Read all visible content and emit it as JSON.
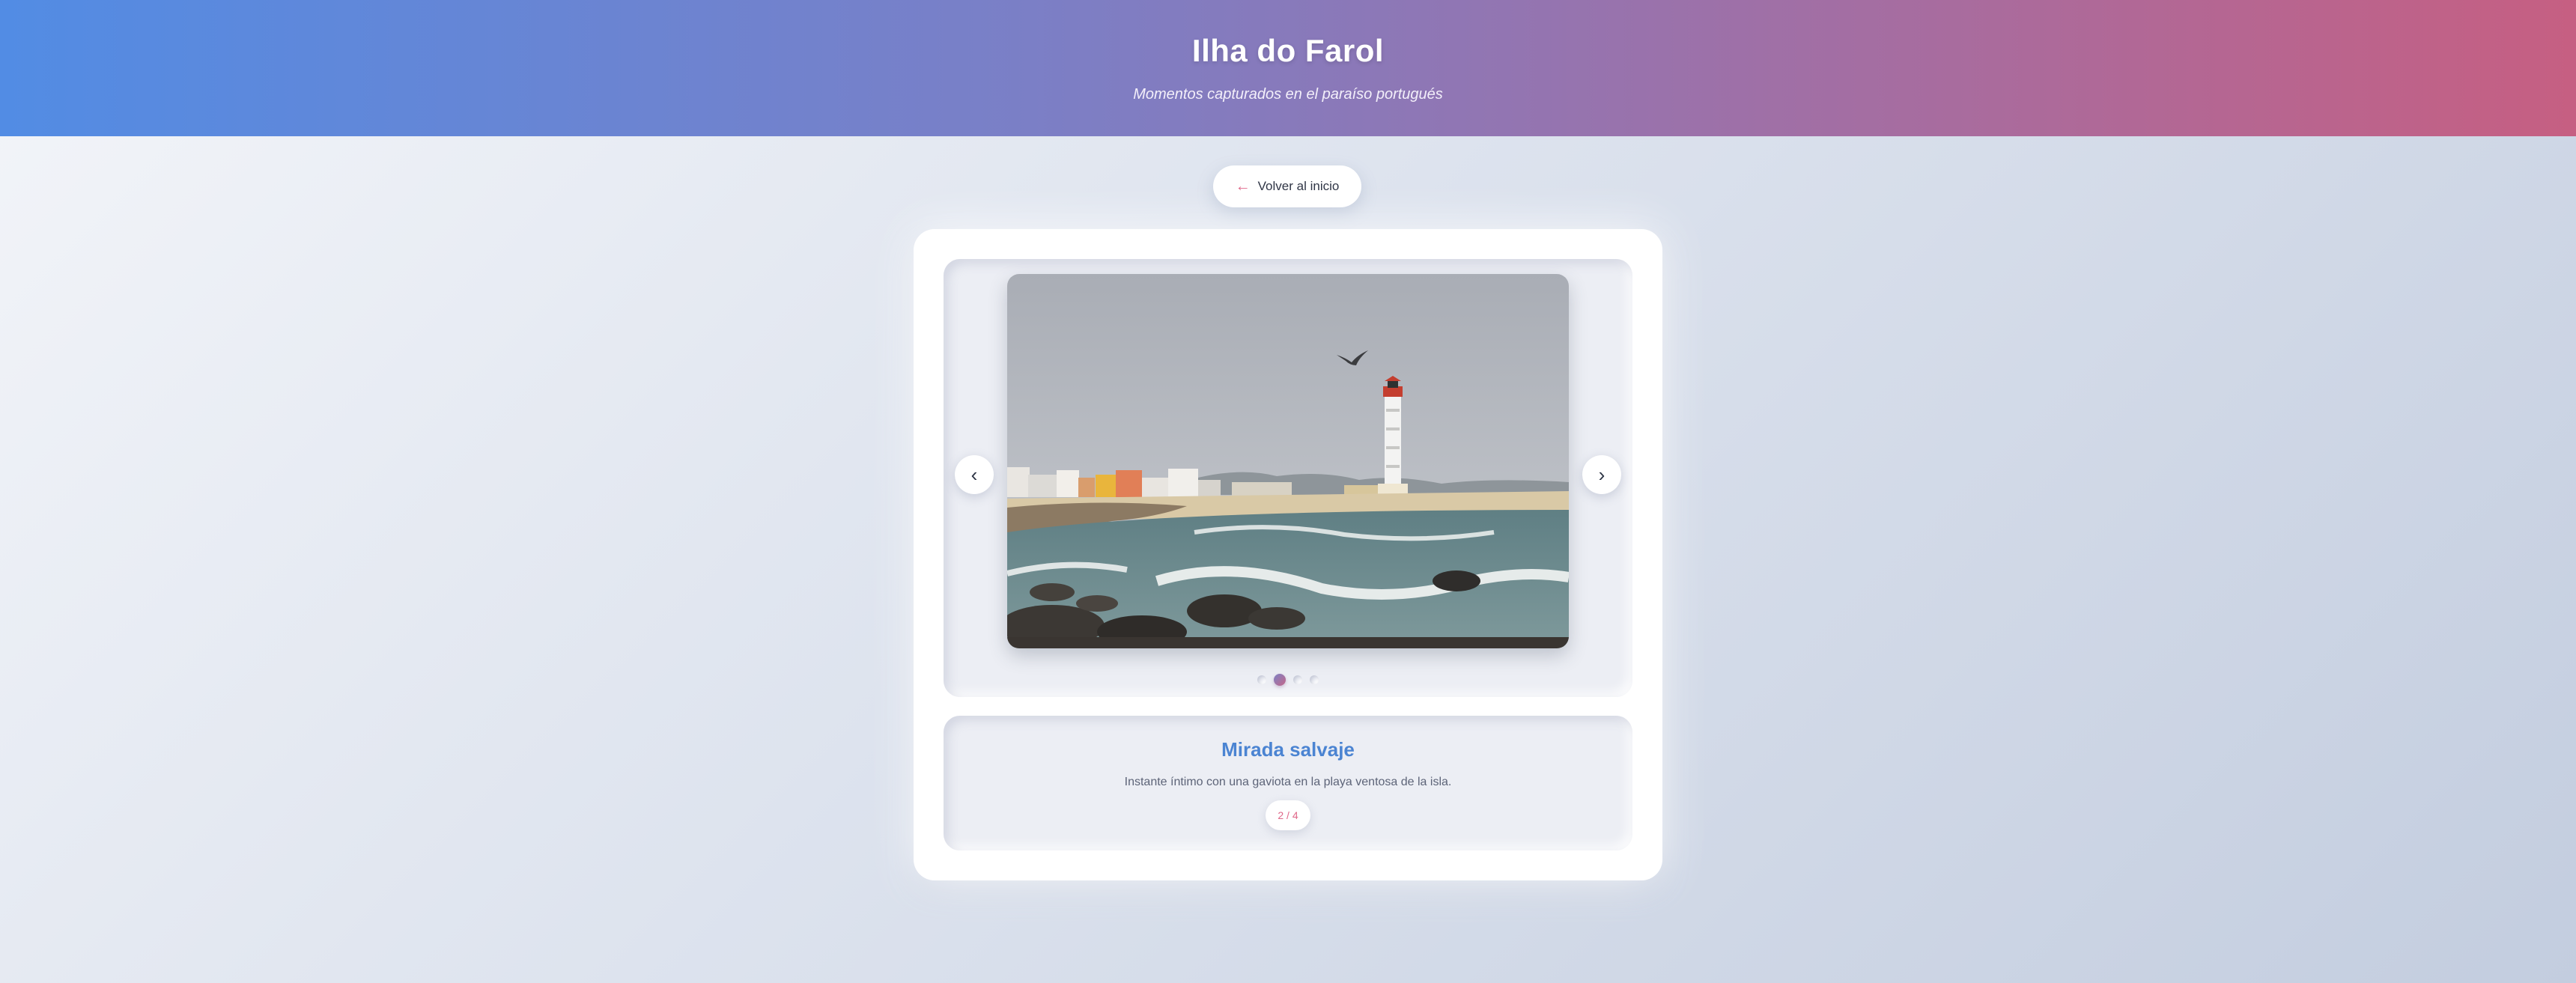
{
  "header": {
    "title": "Ilha do Farol",
    "subtitle": "Momentos capturados en el paraíso portugués"
  },
  "back_button": {
    "arrow": "←",
    "label": "Volver al inicio"
  },
  "gallery": {
    "prev_symbol": "‹",
    "next_symbol": "›",
    "slide_count": 4,
    "active_index": 2,
    "photo_subject": "lighthouse-seaside-photo"
  },
  "caption": {
    "title": "Mirada salvaje",
    "description": "Instante íntimo con una gaviota en la playa ventosa de la isla.",
    "counter": "2 / 4"
  },
  "colors": {
    "header_gradient_start": "#528ce4",
    "header_gradient_end": "#c65f82",
    "accent_blue": "#4b84d2",
    "accent_pink": "#e0688a"
  }
}
